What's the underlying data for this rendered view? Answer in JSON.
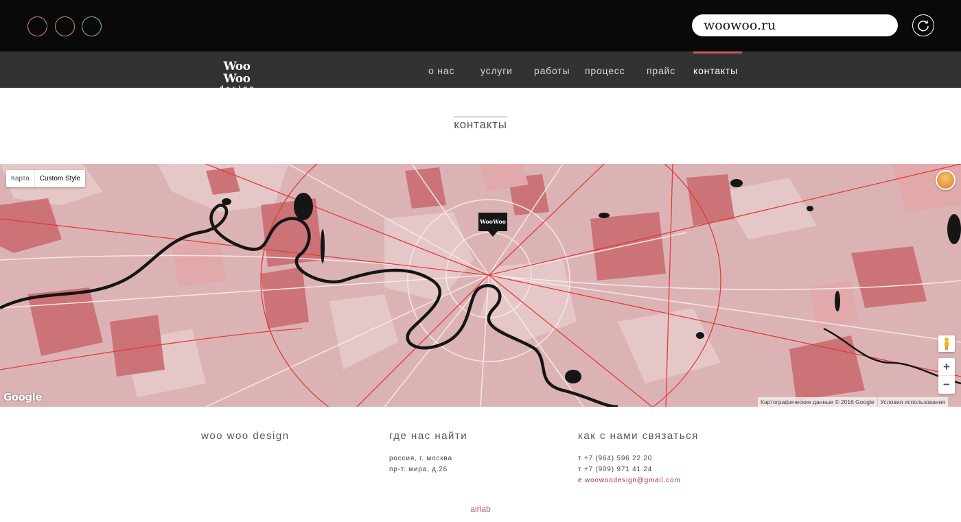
{
  "browser": {
    "url": "woowoo.ru",
    "dot_colors": [
      "#d87ea3",
      "#cf9364",
      "#7cc294"
    ]
  },
  "site": {
    "logo_main": "Woo Woo",
    "logo_sub": "design",
    "nav": [
      {
        "label": "о нас"
      },
      {
        "label": "услуги"
      },
      {
        "label": "работы"
      },
      {
        "label": "процесс"
      },
      {
        "label": "прайс"
      },
      {
        "label": "контакты",
        "active": true
      }
    ],
    "accent_color": "#c6585f"
  },
  "page": {
    "title": "контакты"
  },
  "map": {
    "type_options": [
      "Карта",
      "Custom Style"
    ],
    "selected_type": "Custom Style",
    "marker_label": "WooWoo",
    "zoom_in": "+",
    "zoom_out": "−",
    "provider_logo": "Google",
    "attribution": "Картографические данные © 2016 Google",
    "terms": "Условия использования"
  },
  "footer": {
    "col1": {
      "heading": "woo woo design"
    },
    "col2": {
      "heading": "где нас найти",
      "lines": [
        "россия, г. москва",
        "пр-т. мира, д.26"
      ]
    },
    "col3": {
      "heading": "как с нами связаться",
      "phone1": "т +7 (964) 596 22 20",
      "phone2": "т +7 (909) 971 41 24",
      "email_prefix": "е",
      "email": "woowoodesign@gmail.com"
    },
    "credit": "airlab"
  }
}
